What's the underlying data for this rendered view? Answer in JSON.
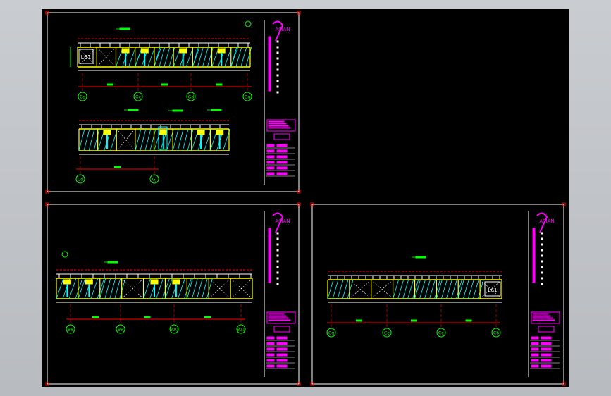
{
  "drawing": {
    "model_space_background": "#000000",
    "app_background": "#bfc2c6",
    "colors": {
      "frame": "#ffffff",
      "wall": "#ffff00",
      "hatch": "#00ffff",
      "dimension": "#00ff00",
      "title_block": "#ff00ff",
      "marker": "#ff0000",
      "axis": "#ff0000"
    },
    "logo_text": "ASIAN",
    "sheets": [
      {
        "id": "sheet-1",
        "elevation_label": "L61",
        "axis_bubbles_top": [
          "Gs",
          "Gc",
          "Gd",
          "Gq"
        ],
        "axis_bubbles_bottom": [
          "Cd",
          "Gj"
        ]
      },
      {
        "id": "sheet-2",
        "axis_bubbles": [
          "B8",
          "B9",
          "B10",
          "B11"
        ]
      },
      {
        "id": "sheet-3",
        "elevation_label": "L61",
        "axis_bubbles": [
          "Cq",
          "Ce",
          "Ce",
          "Cb"
        ]
      }
    ]
  }
}
